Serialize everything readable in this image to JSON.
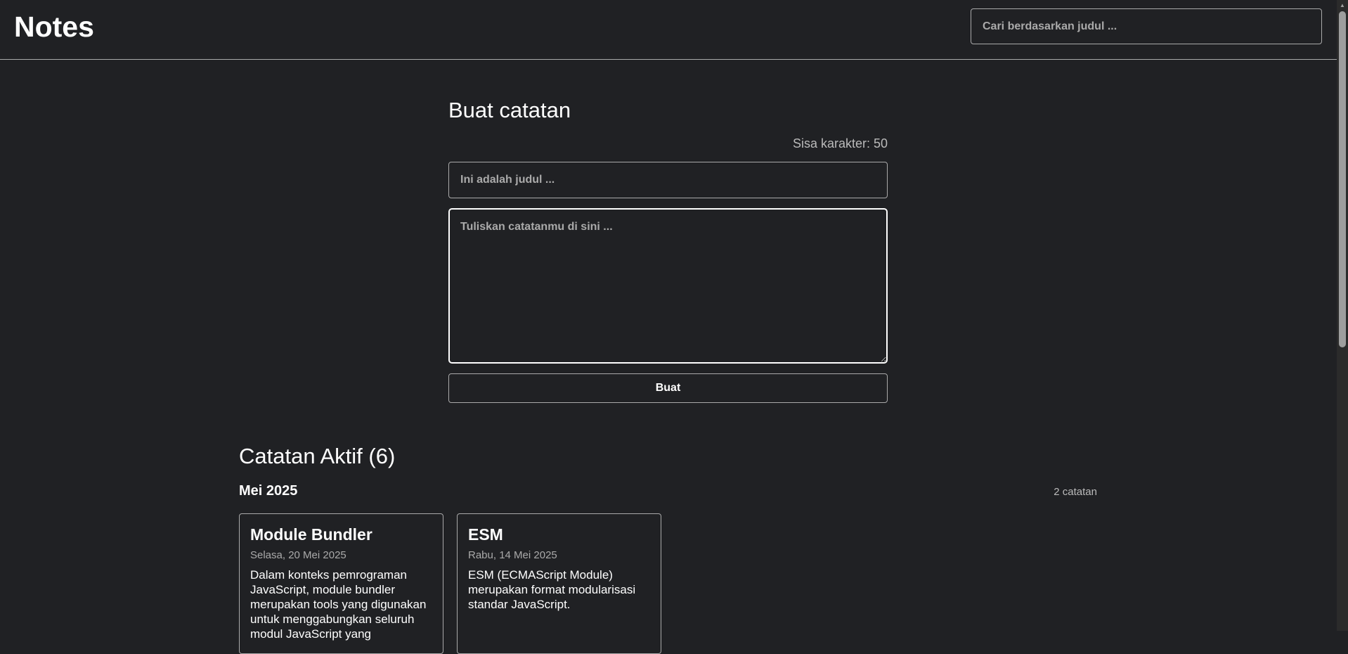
{
  "header": {
    "title": "Notes",
    "search_placeholder": "Cari berdasarkan judul ..."
  },
  "form": {
    "title": "Buat catatan",
    "char_counter": "Sisa karakter: 50",
    "title_placeholder": "Ini adalah judul ...",
    "body_placeholder": "Tuliskan catatanmu di sini ...",
    "submit_label": "Buat"
  },
  "active_notes": {
    "title": "Catatan Aktif (6)",
    "groups": [
      {
        "label": "Mei 2025",
        "count": "2 catatan",
        "notes": [
          {
            "title": "Module Bundler",
            "date": "Selasa, 20 Mei 2025",
            "body": "Dalam konteks pemrograman JavaScript, module bundler merupakan tools yang digunakan untuk menggabungkan seluruh modul JavaScript yang"
          },
          {
            "title": "ESM",
            "date": "Rabu, 14 Mei 2025",
            "body": "ESM (ECMAScript Module) merupakan format modularisasi standar JavaScript."
          }
        ]
      }
    ]
  },
  "colors": {
    "background": "#202124",
    "text": "#ffffff",
    "muted_text": "#aaaaaa",
    "border": "#aaaaaa"
  },
  "icons": {
    "scroll_up": "scroll-up-arrow-icon"
  }
}
